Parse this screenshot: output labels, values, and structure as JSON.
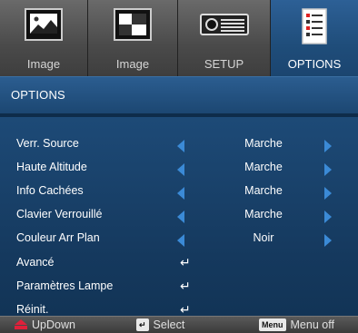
{
  "tabs": [
    {
      "label": "Image",
      "icon": "image-landscape-icon",
      "selected": false
    },
    {
      "label": "Image",
      "icon": "image-contrast-icon",
      "selected": false
    },
    {
      "label": "SETUP",
      "icon": "projector-icon",
      "selected": false
    },
    {
      "label": "OPTIONS",
      "icon": "options-list-icon",
      "selected": true
    }
  ],
  "title": "OPTIONS",
  "rows": [
    {
      "name": "Verr. Source",
      "value": "Marche",
      "type": "toggle"
    },
    {
      "name": "Haute Altitude",
      "value": "Marche",
      "type": "toggle"
    },
    {
      "name": "Info Cachées",
      "value": "Marche",
      "type": "toggle"
    },
    {
      "name": "Clavier Verrouillé",
      "value": "Marche",
      "type": "toggle"
    },
    {
      "name": "Couleur Arr Plan",
      "value": "Noir",
      "type": "toggle"
    },
    {
      "name": "Avancé",
      "value": "↵",
      "type": "submenu"
    },
    {
      "name": "Paramètres Lampe",
      "value": "↵",
      "type": "submenu"
    },
    {
      "name": "Réinit.",
      "value": "↵",
      "type": "submenu"
    }
  ],
  "hints": {
    "updown": "UpDown",
    "select_key": "↵",
    "select": "Select",
    "menu_key": "Menu",
    "menu_off": "Menu off"
  },
  "colors": {
    "accent": "#3b8ad6",
    "title_bg": "#1f4d7a",
    "updown_icon": "#e0203a"
  }
}
